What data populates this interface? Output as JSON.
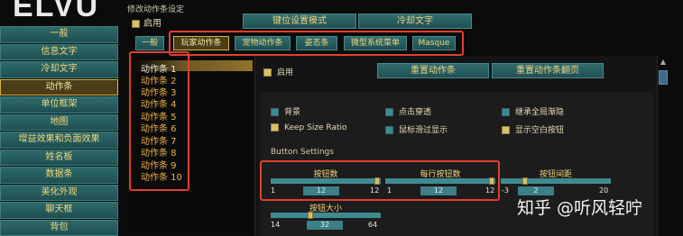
{
  "logo": "ELVU",
  "sidebar": {
    "items": [
      {
        "label": "一般"
      },
      {
        "label": "信息文字"
      },
      {
        "label": "冷却文字"
      },
      {
        "label": "动作条"
      },
      {
        "label": "单位框架"
      },
      {
        "label": "地图"
      },
      {
        "label": "增益效果和负面效果"
      },
      {
        "label": "姓名板"
      },
      {
        "label": "数据条"
      },
      {
        "label": "美化外观"
      },
      {
        "label": "聊天框"
      },
      {
        "label": "背包"
      }
    ],
    "active": "动作条"
  },
  "top": {
    "title": "修改动作条设定",
    "enable_label": "启用",
    "keybind_mode": "键位设置模式",
    "cooldown_text": "冷却文字"
  },
  "tabs": [
    {
      "label": "一般"
    },
    {
      "label": "玩家动作条"
    },
    {
      "label": "宠物动作条"
    },
    {
      "label": "姿态条"
    },
    {
      "label": "微型系统菜单"
    },
    {
      "label": "Masque"
    }
  ],
  "bar_list": [
    "动作条 1",
    "动作条 2",
    "动作条 3",
    "动作条 4",
    "动作条 5",
    "动作条 6",
    "动作条 7",
    "动作条 8",
    "动作条 9",
    "动作条 10"
  ],
  "panel": {
    "enable_label": "启用",
    "reset_bar": "重置动作条",
    "reset_paging": "重置动作条翻页",
    "options": [
      {
        "label": "背景",
        "checked": false
      },
      {
        "label": "点击穿透",
        "checked": false
      },
      {
        "label": "继承全局渐隐",
        "checked": false
      },
      {
        "label": "Keep Size Ratio",
        "checked": true
      },
      {
        "label": "鼠标滑过显示",
        "checked": false
      },
      {
        "label": "显示空白按钮",
        "checked": true
      }
    ],
    "section_title": "Button Settings",
    "sliders": [
      {
        "label": "按钮数",
        "min": "1",
        "value": "12",
        "max": "12",
        "fraction": 1.0
      },
      {
        "label": "每行按钮数",
        "min": "1",
        "value": "12",
        "max": "12",
        "fraction": 1.0
      },
      {
        "label": "按钮间距",
        "min": "-3",
        "value": "2",
        "max": "20",
        "fraction": 0.22
      },
      {
        "label": "按钮大小",
        "min": "14",
        "value": "32",
        "max": "64",
        "fraction": 0.36
      }
    ]
  },
  "watermark": "知乎 @听风轻咛",
  "colors": {
    "accent": "#e0402e",
    "teal": "#3f8a90",
    "gold": "#d9c06a"
  }
}
